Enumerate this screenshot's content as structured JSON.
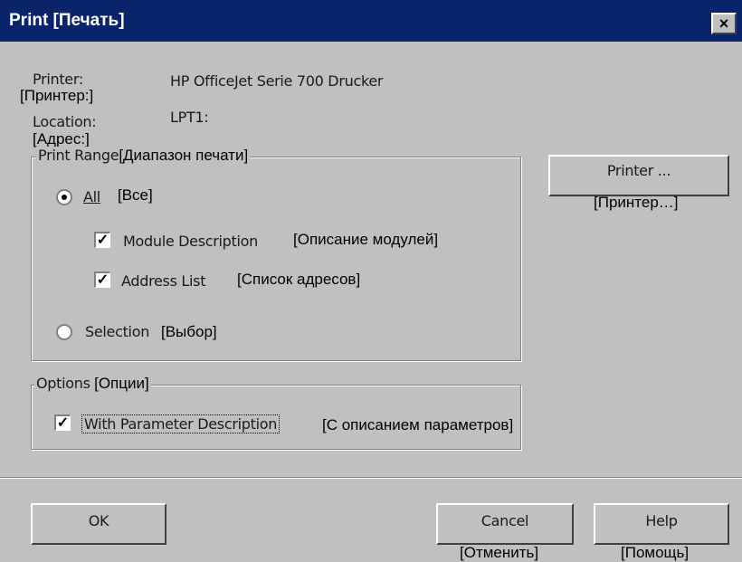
{
  "window": {
    "title": "Print [Печать]",
    "close_glyph": "×"
  },
  "info": {
    "printer_label": "Printer:",
    "printer_label_ru": "[Принтер:]",
    "printer_value": "HP OfficeJet Serie 700 Drucker",
    "location_label": "Location:",
    "location_label_ru": "[Адрес:]",
    "location_value": "LPT1:"
  },
  "print_range": {
    "label": "Print Range",
    "label_ru": "[Диапазон печати]",
    "all": {
      "label": "All",
      "label_ru": "[Все]",
      "selected": true
    },
    "module_description": {
      "label": "Module Description",
      "label_ru": "[Описание модулей]",
      "checked": true
    },
    "address_list": {
      "label": "Address List",
      "label_ru": "[Список адресов]",
      "checked": true
    },
    "selection": {
      "label": "Selection",
      "label_ru": "[Выбор]",
      "selected": false
    }
  },
  "options": {
    "label": "Options",
    "label_ru": "[Опции]",
    "with_param": {
      "label": "With Parameter Description",
      "label_ru": "[С описанием параметров]",
      "checked": true
    }
  },
  "buttons": {
    "printer": {
      "label": "Printer ...",
      "label_ru": "[Принтер…]"
    },
    "ok": {
      "label": "OK"
    },
    "cancel": {
      "label": "Cancel",
      "label_ru": "[Отменить]"
    },
    "help": {
      "label": "Help",
      "label_ru": "[Помощь]"
    }
  },
  "colors": {
    "titlebar": "#0a246a",
    "dialog": "#c0c0c0"
  }
}
